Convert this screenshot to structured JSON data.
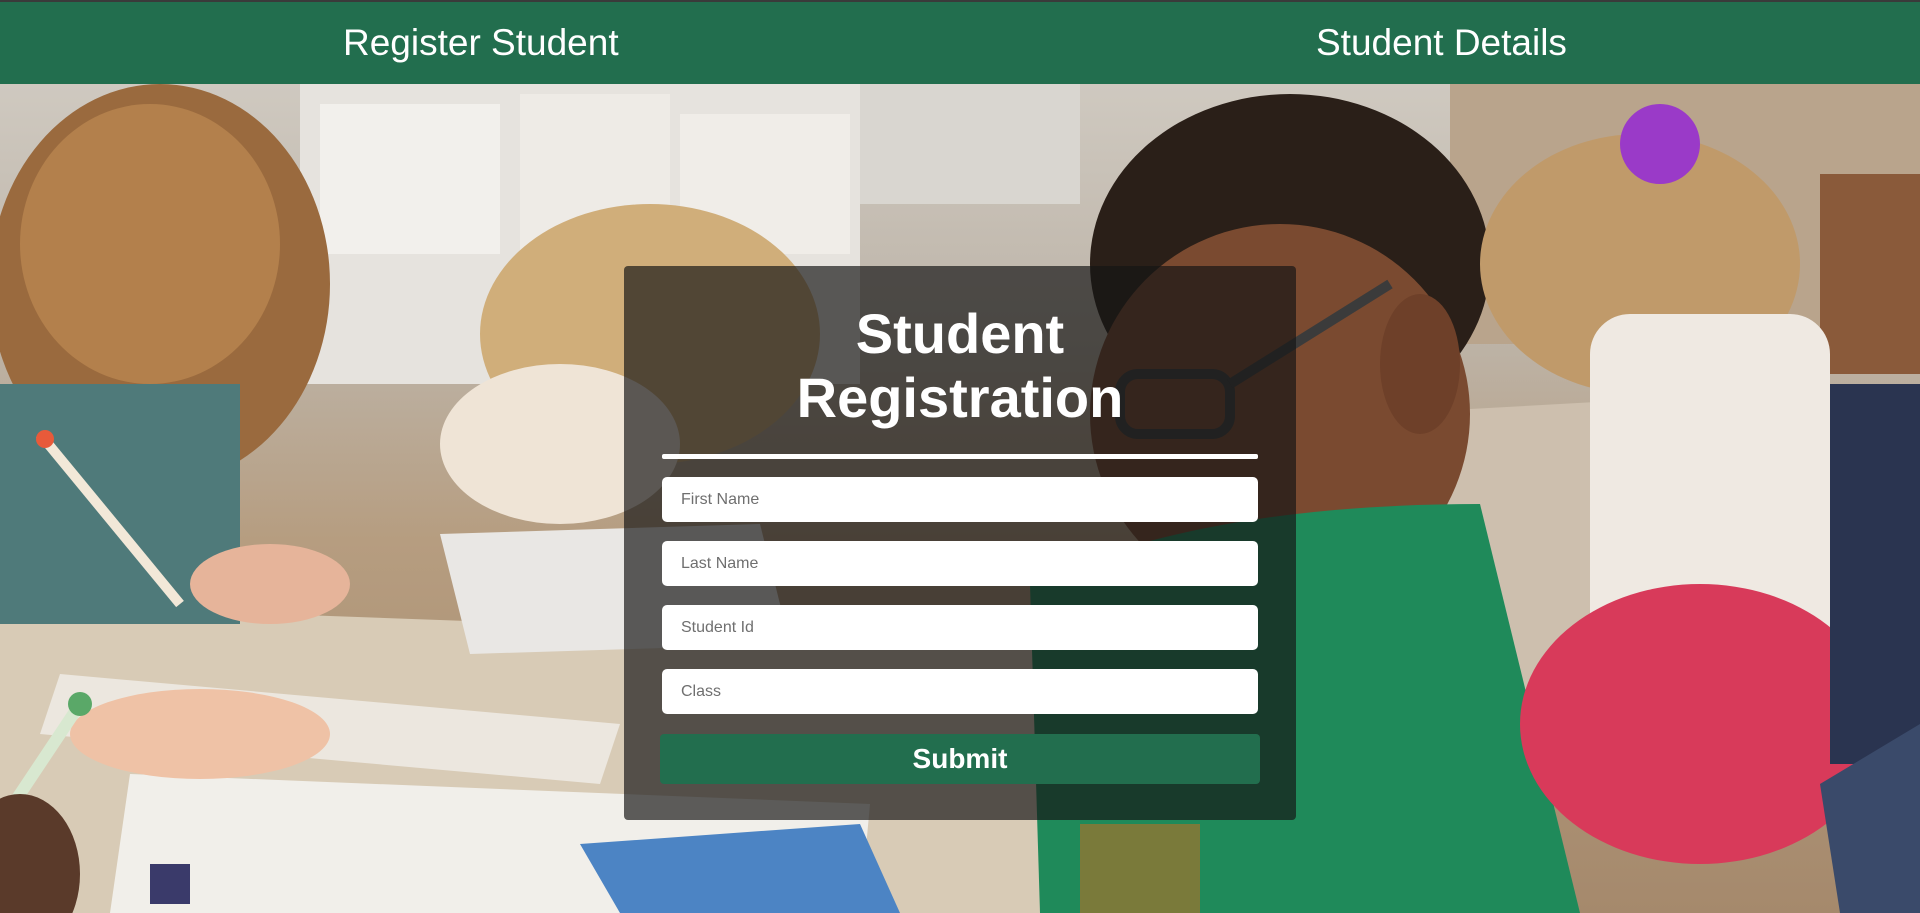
{
  "nav": {
    "register_label": "Register Student",
    "details_label": "Student Details"
  },
  "form": {
    "title_line1": "Student",
    "title_line2": "Registration",
    "first_name_placeholder": "First Name",
    "last_name_placeholder": "Last Name",
    "student_id_placeholder": "Student Id",
    "class_placeholder": "Class",
    "submit_label": "Submit"
  },
  "colors": {
    "brand_green": "#226e4e",
    "card_overlay": "rgba(20,20,20,0.68)"
  }
}
